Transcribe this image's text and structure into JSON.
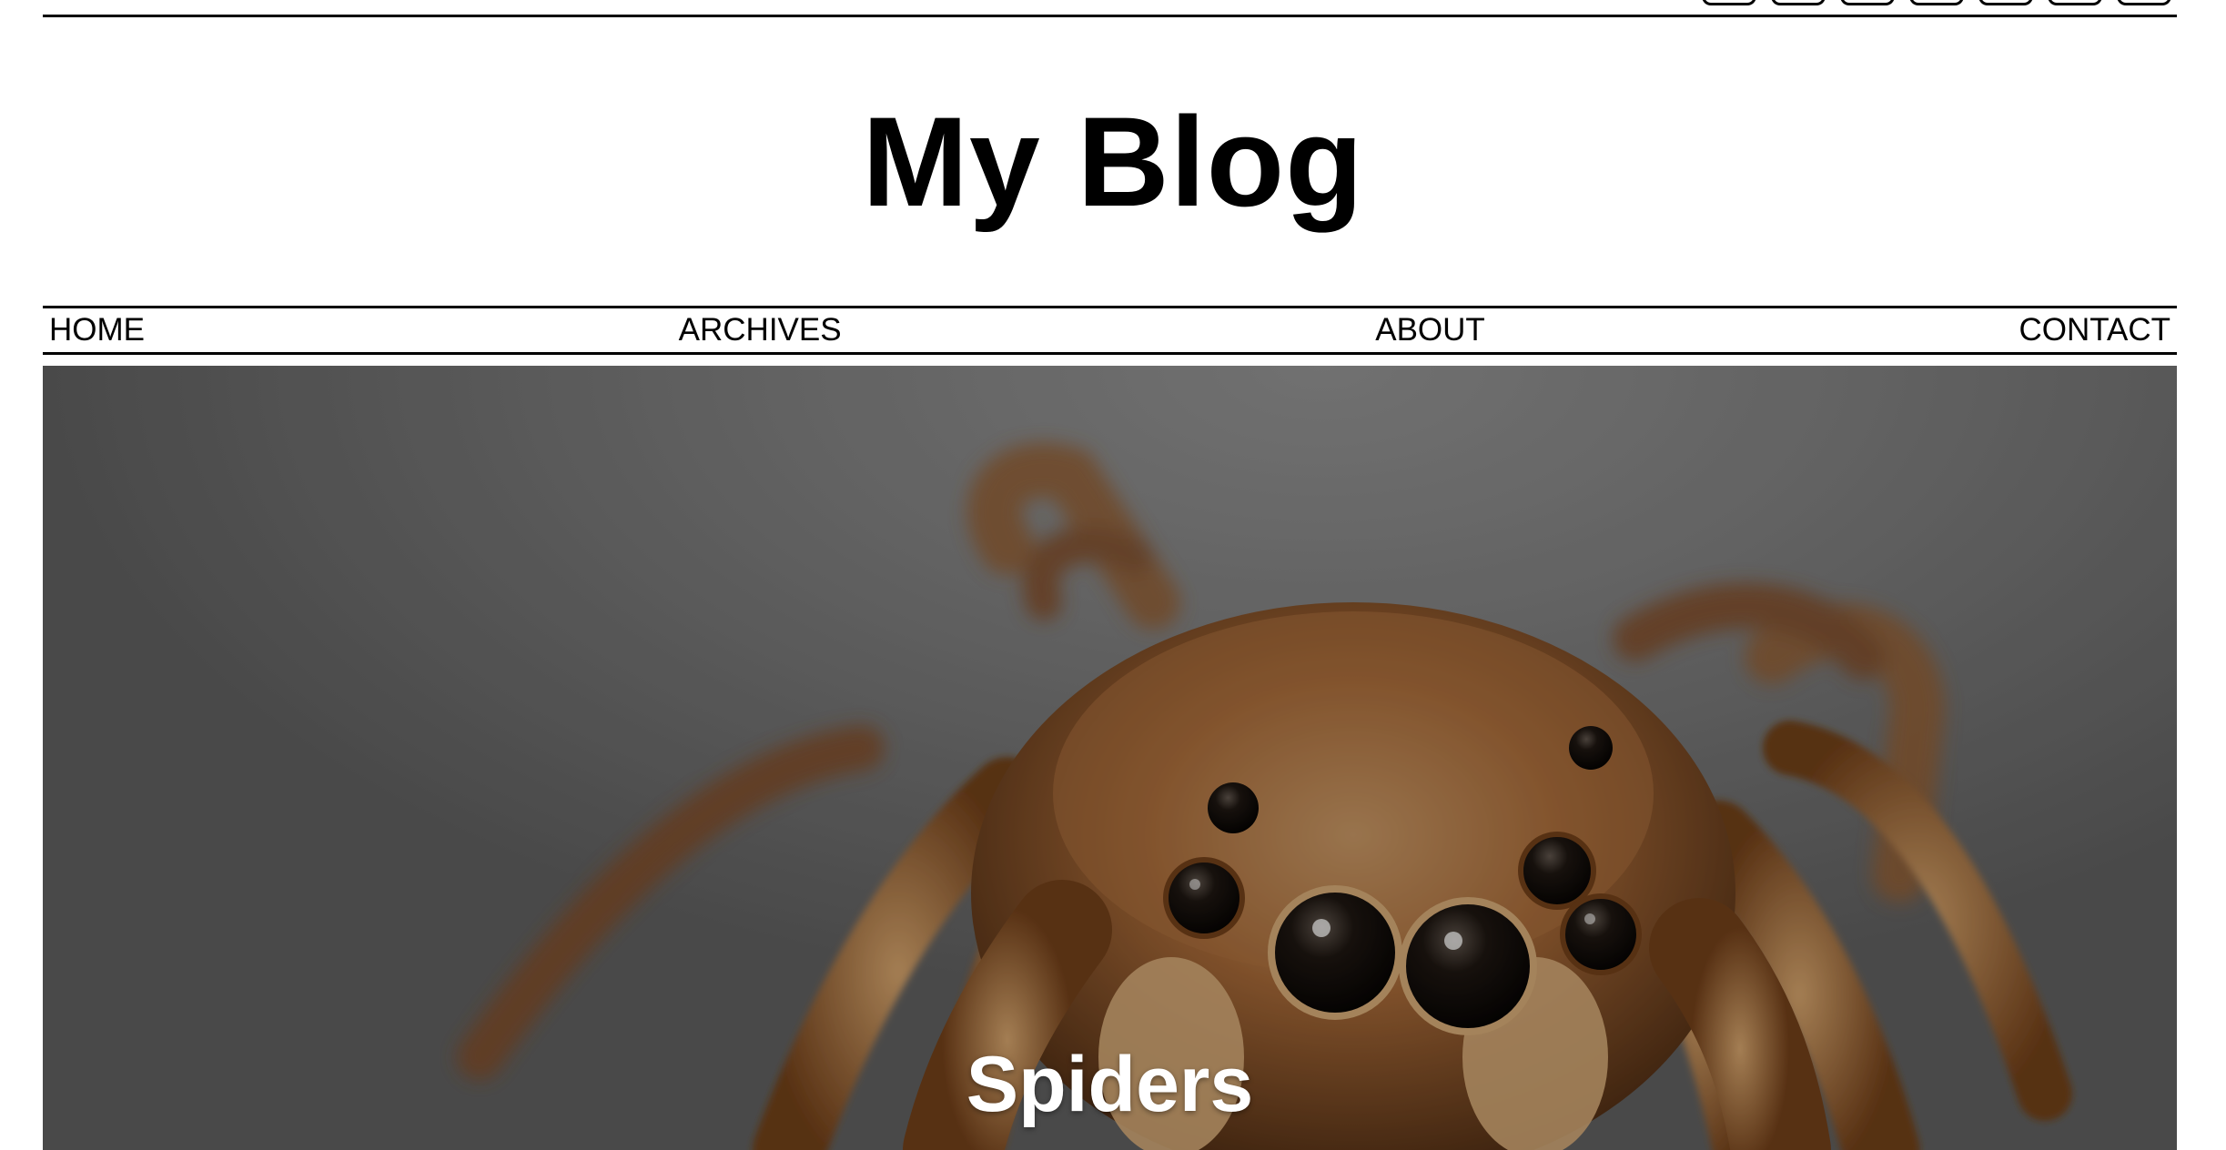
{
  "site": {
    "title": "My Blog"
  },
  "social_icons": [
    "social-icon",
    "social-icon",
    "social-icon",
    "social-icon",
    "social-icon",
    "social-icon",
    "social-icon"
  ],
  "nav": {
    "items": [
      {
        "label": "HOME"
      },
      {
        "label": "ARCHIVES"
      },
      {
        "label": "ABOUT"
      },
      {
        "label": "CONTACT"
      }
    ]
  },
  "hero": {
    "title": "Spiders",
    "image_subject": "jumping-spider-photo"
  },
  "colors": {
    "text": "#000000",
    "background": "#ffffff",
    "hero_text": "#ffffff",
    "hero_bg": "#6e6e6e",
    "spider_fur": "#8b5a2b"
  }
}
